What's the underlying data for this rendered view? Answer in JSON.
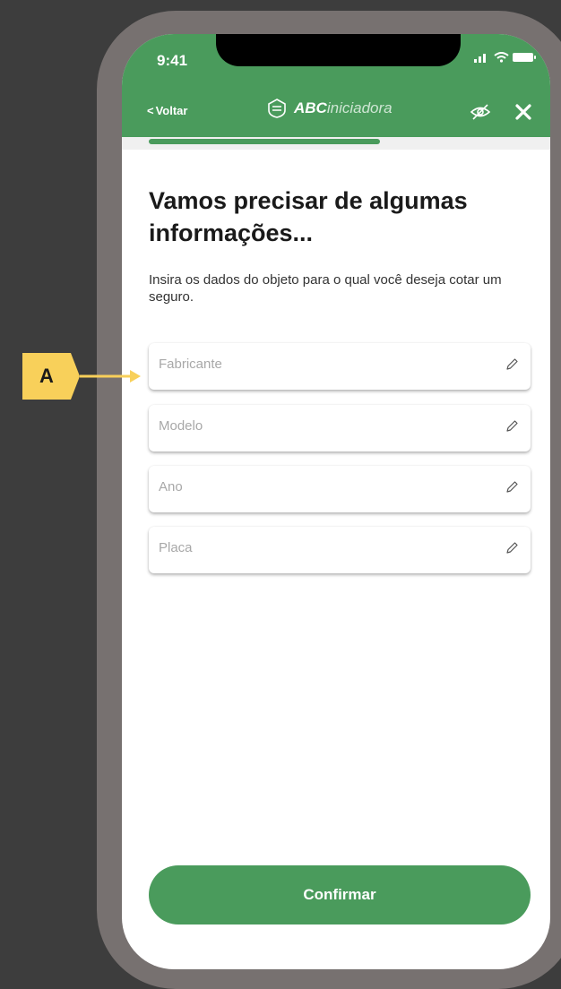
{
  "status_bar": {
    "time": "9:41",
    "icons": [
      "signal-icon",
      "wifi-icon",
      "battery-icon"
    ]
  },
  "nav": {
    "back_label": "Voltar",
    "brand_bold": "ABC",
    "brand_light": "iniciadora",
    "icons": [
      "shield-logo-icon",
      "eye-off-icon",
      "close-icon"
    ]
  },
  "progress": {
    "fraction": 0.54
  },
  "content": {
    "title": "Vamos precisar de algumas informações...",
    "subtitle": "Insira os dados do objeto para o qual você deseja cotar um seguro."
  },
  "fields": [
    {
      "label": "Fabricante"
    },
    {
      "label": "Modelo"
    },
    {
      "label": "Ano"
    },
    {
      "label": "Placa"
    }
  ],
  "confirm_label": "Confirmar",
  "annotation": {
    "label": "A"
  },
  "colors": {
    "brand_green": "#4a9b5c",
    "frame": "#777170",
    "background": "#3d3d3d",
    "callout": "#f8d05a"
  }
}
